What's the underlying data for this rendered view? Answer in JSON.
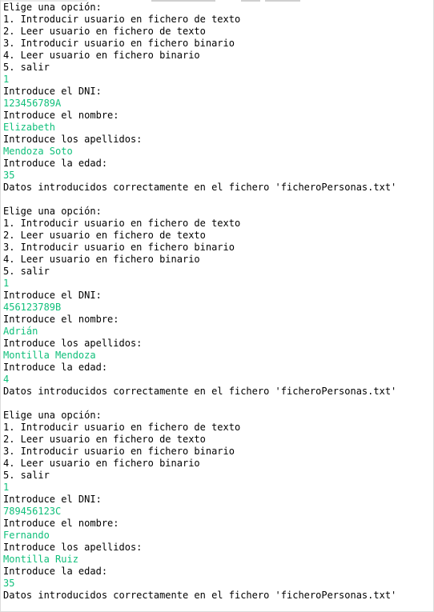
{
  "window": {
    "title": ""
  },
  "colors": {
    "output_text": "#000000",
    "input_text": "#0fbf7a",
    "background": "#ffffff"
  },
  "blocks": [
    {
      "menu_title": "Elige una opción:",
      "options": [
        "1. Introducir usuario en fichero de texto",
        "2. Leer usuario en fichero de texto",
        "3. Introducir usuario en fichero binario",
        "4. Leer usuario en fichero binario",
        "5. salir"
      ],
      "choice": "1",
      "dni_prompt": "Introduce el DNI:",
      "dni": "123456789A",
      "name_prompt": "Introduce el nombre:",
      "name": "Elizabeth",
      "surname_prompt": "Introduce los apellidos:",
      "surname": "Mendoza Soto",
      "age_prompt": "Introduce la edad:",
      "age": "35",
      "result": "Datos introducidos correctamente en el fichero 'ficheroPersonas.txt'"
    },
    {
      "menu_title": "Elige una opción:",
      "options": [
        "1. Introducir usuario en fichero de texto",
        "2. Leer usuario en fichero de texto",
        "3. Introducir usuario en fichero binario",
        "4. Leer usuario en fichero binario",
        "5. salir"
      ],
      "choice": "1",
      "dni_prompt": "Introduce el DNI:",
      "dni": "456123789B",
      "name_prompt": "Introduce el nombre:",
      "name": "Adrián",
      "surname_prompt": "Introduce los apellidos:",
      "surname": "Montilla Mendoza",
      "age_prompt": "Introduce la edad:",
      "age": "4",
      "result": "Datos introducidos correctamente en el fichero 'ficheroPersonas.txt'"
    },
    {
      "menu_title": "Elige una opción:",
      "options": [
        "1. Introducir usuario en fichero de texto",
        "2. Leer usuario en fichero de texto",
        "3. Introducir usuario en fichero binario",
        "4. Leer usuario en fichero binario",
        "5. salir"
      ],
      "choice": "1",
      "dni_prompt": "Introduce el DNI:",
      "dni": "789456123C",
      "name_prompt": "Introduce el nombre:",
      "name": "Fernando",
      "surname_prompt": "Introduce los apellidos:",
      "surname": "Montilla Ruiz",
      "age_prompt": "Introduce la edad:",
      "age": "35",
      "result": "Datos introducidos correctamente en el fichero 'ficheroPersonas.txt'"
    }
  ]
}
